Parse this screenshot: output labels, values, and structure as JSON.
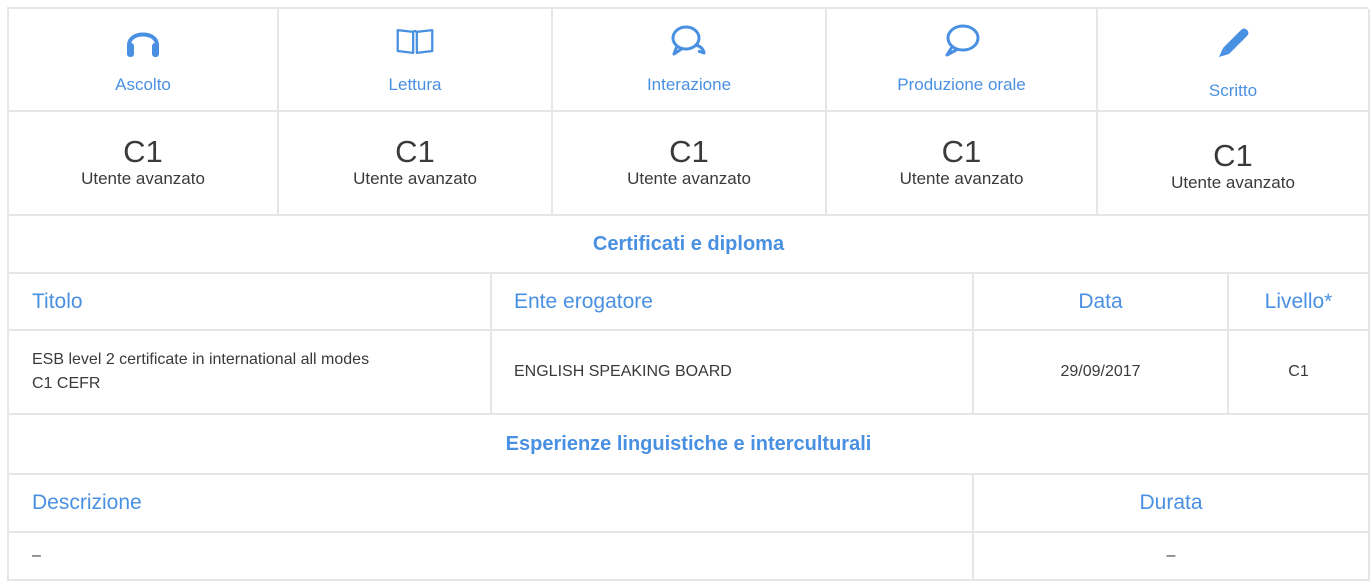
{
  "skills": [
    {
      "icon": "headphones-icon",
      "label": "Ascolto"
    },
    {
      "icon": "book-icon",
      "label": "Lettura"
    },
    {
      "icon": "speech-bubbles-icon",
      "label": "Interazione"
    },
    {
      "icon": "speech-bubble-icon",
      "label": "Produzione orale"
    },
    {
      "icon": "pencil-icon",
      "label": "Scritto"
    }
  ],
  "levels": [
    {
      "code": "C1",
      "desc": "Utente avanzato"
    },
    {
      "code": "C1",
      "desc": "Utente avanzato"
    },
    {
      "code": "C1",
      "desc": "Utente avanzato"
    },
    {
      "code": "C1",
      "desc": "Utente avanzato"
    },
    {
      "code": "C1",
      "desc": "Utente avanzato"
    }
  ],
  "certificates": {
    "title": "Certificati e diploma",
    "headers": {
      "titolo": "Titolo",
      "ente": "Ente erogatore",
      "data": "Data",
      "livello": "Livello*"
    },
    "rows": [
      {
        "titolo_line1": "ESB level 2 certificate in international all modes",
        "titolo_line2": "C1 CEFR",
        "ente": "ENGLISH SPEAKING BOARD",
        "data": "29/09/2017",
        "livello": "C1"
      }
    ]
  },
  "experiences": {
    "title": "Esperienze linguistiche e interculturali",
    "headers": {
      "descrizione": "Descrizione",
      "durata": "Durata"
    },
    "rows": [
      {
        "descrizione": "–",
        "durata": "–"
      }
    ]
  },
  "colors": {
    "accent": "#4a90e2",
    "border": "#e6e6e6",
    "text": "#3a3a3a"
  }
}
